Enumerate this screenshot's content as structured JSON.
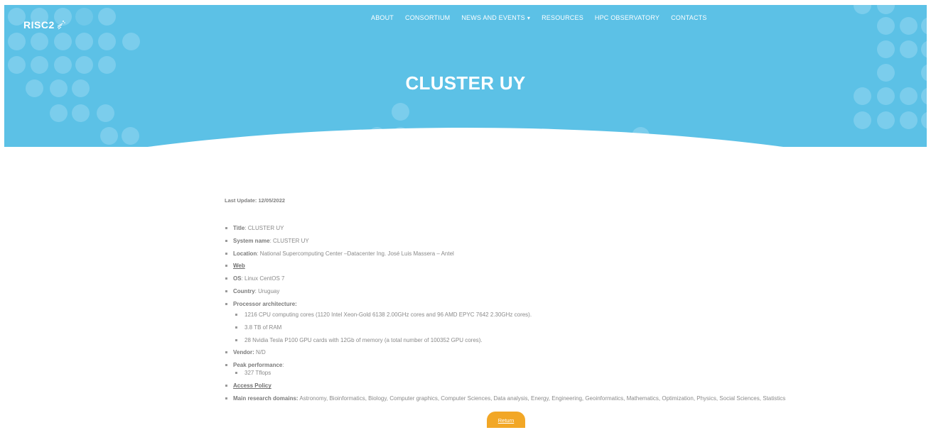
{
  "header": {
    "logo_text": "RISC2",
    "nav": [
      {
        "label": "ABOUT"
      },
      {
        "label": "CONSORTIUM"
      },
      {
        "label": "NEWS AND EVENTS",
        "has_dropdown": true
      },
      {
        "label": "RESOURCES"
      },
      {
        "label": "HPC OBSERVATORY"
      },
      {
        "label": "CONTACTS"
      }
    ],
    "page_title": "CLUSTER UY"
  },
  "content": {
    "last_update": "Last Update: 12/05/2022",
    "title": {
      "label": "Title",
      "value": ": CLUSTER UY"
    },
    "system_name": {
      "label": "System name",
      "value": ": CLUSTER UY"
    },
    "location": {
      "label": "Location",
      "value": ": National Supercomputing Center –Datacenter Ing. José Luis Massera – Antel"
    },
    "web": {
      "label": "Web"
    },
    "os": {
      "label": "OS",
      "value": ": Linux CentOS 7"
    },
    "country": {
      "label": "Country",
      "value": ": Uruguay"
    },
    "processor": {
      "label": "Processor architecture:",
      "items": [
        "1216 CPU computing cores (1120 Intel Xeon-Gold 6138 2.00GHz cores and 96 AMD EPYC 7642 2.30GHz cores).",
        "3.8 TB of RAM",
        "28 Nvidia Tesla P100 GPU cards with 12Gb of memory (a total number of 100352 GPU cores)."
      ]
    },
    "vendor": {
      "label": "Vendor:",
      "value": " N/D"
    },
    "peak": {
      "label": "Peak performance",
      "value": ":",
      "items": [
        "327 Tflops"
      ]
    },
    "access_policy": {
      "label": "Access Policy"
    },
    "domains": {
      "label": "Main research domains:",
      "value": " Astronomy, Bioinformatics, Biology, Computer graphics, Computer Sciences, Data analysis, Energy, Engineering, Geoinformatics, Mathematics, Optimization, Physics, Social Sciences, Statistics"
    }
  },
  "return_button": "Return",
  "colors": {
    "hero": "#5cc1e6",
    "accent": "#f2a726"
  }
}
